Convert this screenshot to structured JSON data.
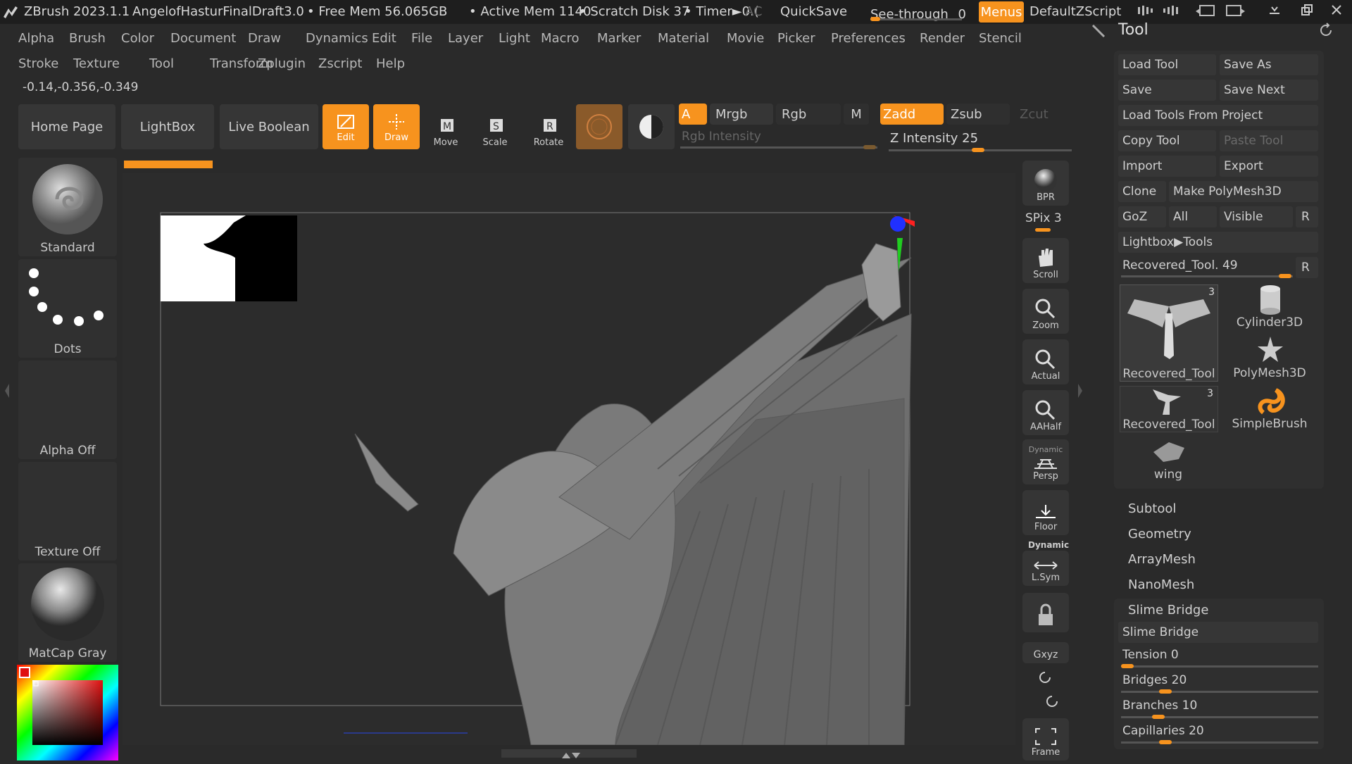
{
  "titlebar": {
    "app": "ZBrush 2023.1.1",
    "document": "AngelofHasturFinalDraft3.0",
    "free_mem": "• Free Mem 56.065GB",
    "active_mem": "• Active Mem 1140",
    "scratch": "• Scratch Disk 37",
    "timer": "• Timer►0.(",
    "ac": "AC",
    "quicksave": "QuickSave",
    "seethrough": "See-through",
    "seethrough_val": "0",
    "menus": "Menus",
    "script": "DefaultZScript"
  },
  "menu_row1": [
    "Alpha",
    "Brush",
    "Color",
    "Document",
    "Draw",
    "Dynamics",
    "Edit",
    "File",
    "Layer",
    "Light",
    "Macro",
    "Marker",
    "Material",
    "Movie",
    "Picker",
    "Preferences",
    "Render",
    "Stencil"
  ],
  "menu_row2": [
    "Stroke",
    "Texture",
    "Tool",
    "Transform",
    "Zplugin",
    "Zscript",
    "Help"
  ],
  "coords": "-0.14,-0.356,-0.349",
  "shelf": {
    "home": "Home Page",
    "lightbox": "LightBox",
    "live_boolean": "Live Boolean",
    "edit": "Edit",
    "draw": "Draw",
    "move": "Move",
    "scale": "Scale",
    "rotate": "Rotate",
    "a": "A",
    "mrgb": "Mrgb",
    "rgb": "Rgb",
    "m": "M",
    "zadd": "Zadd",
    "zsub": "Zsub",
    "zcut": "Zcut",
    "rgb_intensity": "Rgb Intensity",
    "z_intensity": "Z Intensity 25"
  },
  "left": {
    "brush": "Standard",
    "stroke": "Dots",
    "alpha": "Alpha Off",
    "texture": "Texture Off",
    "material": "MatCap Gray"
  },
  "nav": {
    "bpr": "BPR",
    "spix": "SPix 3",
    "scroll": "Scroll",
    "zoom": "Zoom",
    "actual": "Actual",
    "aahalf": "AAHalf",
    "dynamic1": "Dynamic",
    "persp": "Persp",
    "floor": "Floor",
    "dynamic2": "Dynamic",
    "lsym": "L.Sym",
    "xyz": "Gxyz",
    "frame": "Frame"
  },
  "tool": {
    "title": "Tool",
    "load_tool": "Load Tool",
    "save_as": "Save As",
    "save": "Save",
    "save_next": "Save Next",
    "load_from_project": "Load Tools From Project",
    "copy_tool": "Copy Tool",
    "paste_tool": "Paste Tool",
    "import": "Import",
    "export": "Export",
    "clone": "Clone",
    "make_polymesh": "Make PolyMesh3D",
    "goz": "GoZ",
    "all": "All",
    "visible": "Visible",
    "r": "R",
    "lightbox_tools": "Lightbox▶Tools",
    "recovered_slider": "Recovered_Tool. 49",
    "thumbs": [
      {
        "label": "Recovered_Tool",
        "badge": "3"
      },
      {
        "label": "Cylinder3D",
        "badge": ""
      },
      {
        "label": "PolyMesh3D",
        "badge": ""
      },
      {
        "label": "Recovered_Tool",
        "badge": "3"
      },
      {
        "label": "SimpleBrush",
        "badge": ""
      },
      {
        "label": "wing",
        "badge": ""
      }
    ],
    "sections": [
      "Subtool",
      "Geometry",
      "ArrayMesh",
      "NanoMesh",
      "Slime Bridge"
    ],
    "slime_bridge_btn": "Slime Bridge",
    "sliders": [
      {
        "label": "Tension 0",
        "value": 0
      },
      {
        "label": "Bridges 20",
        "value": 20
      },
      {
        "label": "Branches 10",
        "value": 10
      },
      {
        "label": "Capillaries 20",
        "value": 20
      }
    ]
  }
}
